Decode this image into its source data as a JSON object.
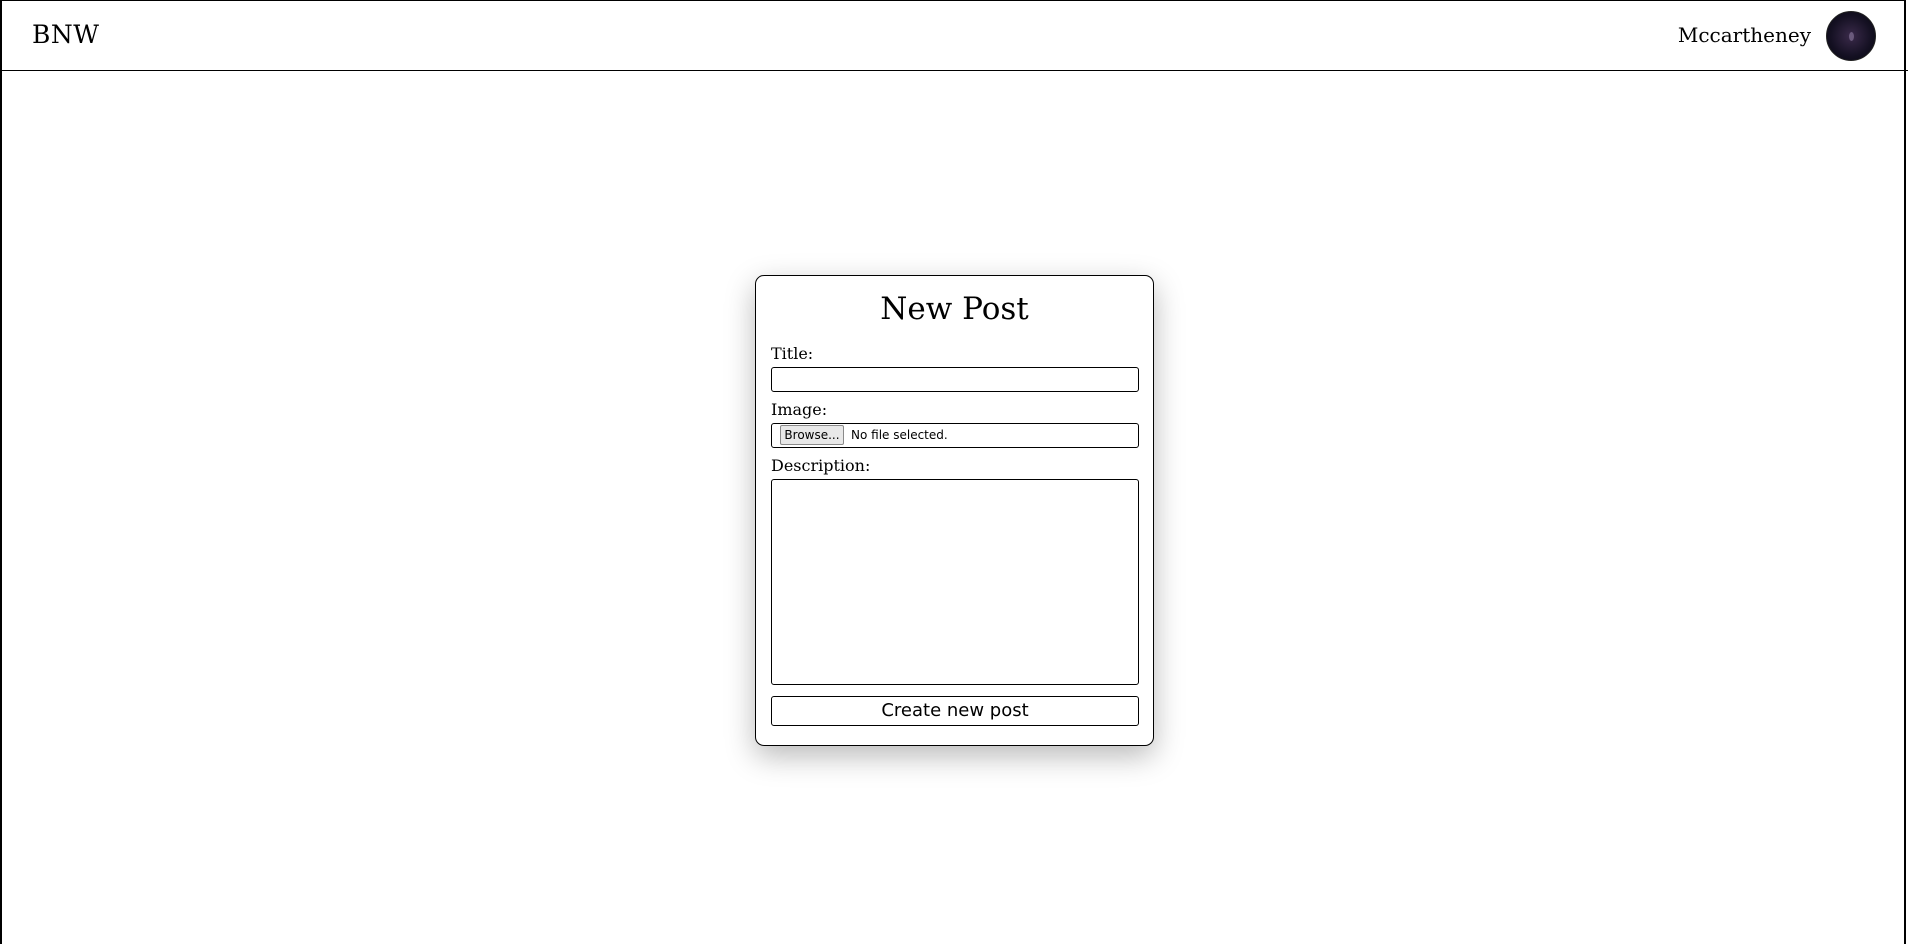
{
  "header": {
    "brand": "BNW",
    "username": "Mccartheney"
  },
  "form": {
    "heading": "New Post",
    "title_label": "Title:",
    "title_value": "",
    "image_label": "Image:",
    "browse_label": "Browse...",
    "file_status": "No file selected.",
    "description_label": "Description:",
    "description_value": "",
    "submit_label": "Create new post"
  }
}
